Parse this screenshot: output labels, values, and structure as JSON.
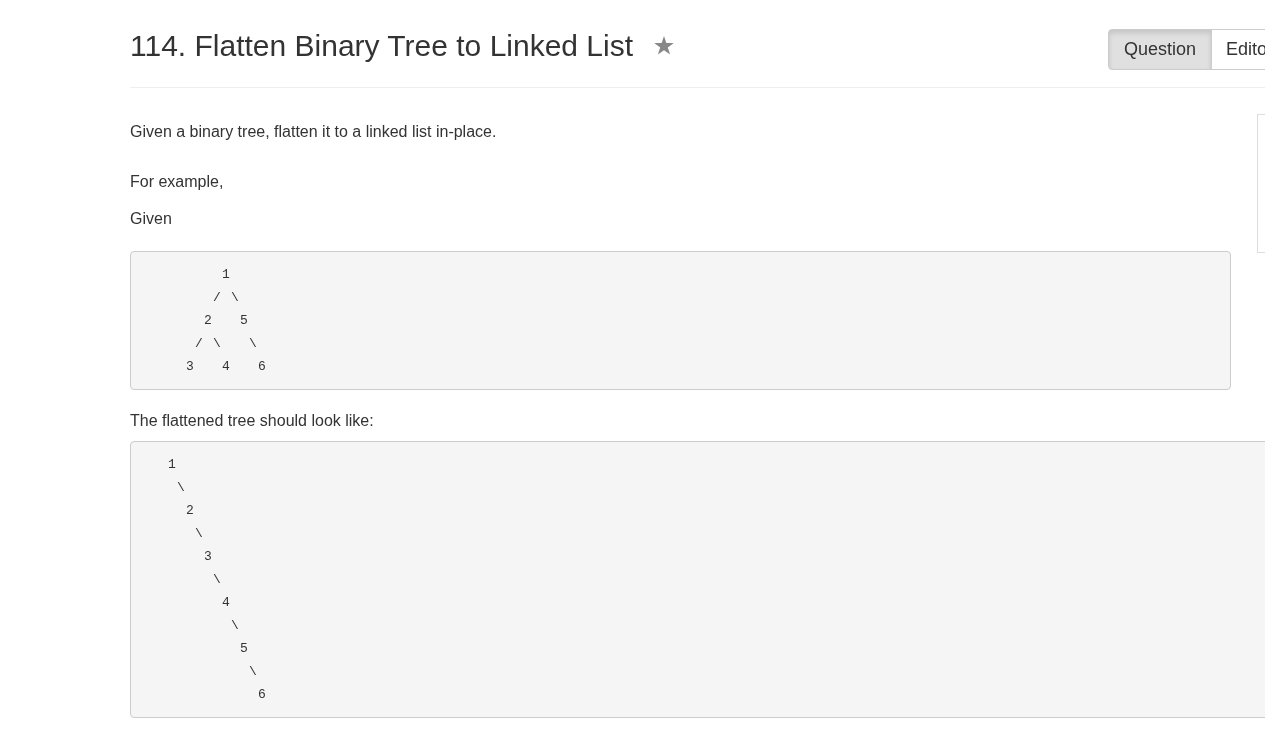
{
  "header": {
    "title": "114. Flatten Binary Tree to Linked List",
    "tabs": [
      {
        "label": "Question",
        "selected": true
      },
      {
        "label": "Edito",
        "selected": false
      }
    ]
  },
  "description": {
    "intro": "Given a binary tree, flatten it to a linked list in-place.",
    "example_label": "For example,",
    "given_label": "Given",
    "input_tree": [
      "         1",
      "        / \\",
      "       2   5",
      "      / \\   \\",
      "     3   4   6"
    ],
    "output_caption": "The flattened tree should look like:",
    "output_tree": [
      "   1",
      "    \\",
      "     2",
      "      \\",
      "       3",
      "        \\",
      "         4",
      "          \\",
      "           5",
      "            \\",
      "             6"
    ]
  }
}
